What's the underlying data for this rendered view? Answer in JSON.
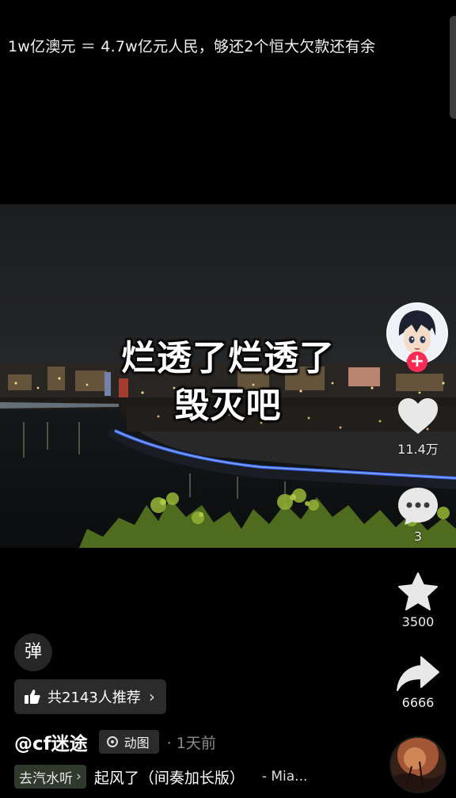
{
  "caption": "1w亿澳元 ＝ 4.7w亿元人民，够还2个恒大欠款还有余",
  "video": {
    "overlay_line1": "烂透了烂透了",
    "overlay_line2": "毁灭吧"
  },
  "actions": {
    "follow_symbol": "+",
    "like_count": "11.4万",
    "comment_count": "3",
    "favorite_count": "3500",
    "share_count": "6666"
  },
  "danmaku_label": "弹",
  "recommend": {
    "label": "共2143人推荐",
    "chevron": "›"
  },
  "author": {
    "name": "@cf迷途",
    "tag": "动图",
    "time": "· 1天前"
  },
  "music": {
    "source": "去汽水听",
    "source_arrow": "›",
    "title": "起风了（间奏加长版）",
    "artist": "- Mia..."
  },
  "colors": {
    "background": "#000000",
    "accent": "#fe2c55",
    "pill": "#2b2b2b"
  }
}
